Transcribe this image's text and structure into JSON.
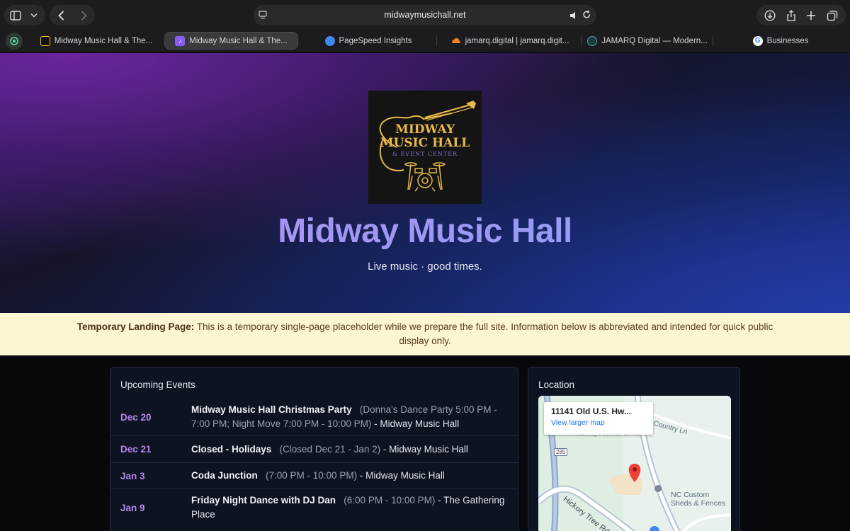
{
  "browser": {
    "url": "midwaymusichall.net",
    "tabs": [
      {
        "label": "Midway Music Hall & The...",
        "active": false,
        "favicon_color": "#f3c400"
      },
      {
        "label": "Midway Music Hall & The...",
        "active": true,
        "favicon_color": "#8b5cf6"
      },
      {
        "label": "PageSpeed Insights",
        "active": false,
        "favicon_color": "#4285f4"
      },
      {
        "label": "jamarq.digital | jamarq.digit...",
        "active": false,
        "favicon_color": "#f38020"
      },
      {
        "label": "JAMARQ Digital — Modern...",
        "active": false,
        "favicon_color": "#3fa6a6"
      },
      {
        "label": "Businesses",
        "active": false,
        "favicon_color": "#4285f4"
      }
    ]
  },
  "hero": {
    "logo": {
      "line1": "MIDWAY",
      "line2": "MUSIC HALL",
      "line3": "& EVENT CENTER"
    },
    "title": "Midway Music Hall",
    "subtitle": "Live music · good times."
  },
  "notice": {
    "label": "Temporary Landing Page:",
    "text": "This is a temporary single-page placeholder while we prepare the full site. Information below is abbreviated and intended for quick public display only."
  },
  "events": {
    "heading": "Upcoming Events",
    "items": [
      {
        "date": "Dec 20",
        "title": "Midway Music Hall Christmas Party",
        "time": "(Donna's Dance Party 5:00 PM - 7:00 PM; Night Move 7:00 PM - 10:00 PM)",
        "venue": "- Midway Music Hall"
      },
      {
        "date": "Dec 21",
        "title": "Closed - Holidays",
        "time": "(Closed Dec 21 - Jan 2)",
        "venue": "- Midway Music Hall"
      },
      {
        "date": "Jan 3",
        "title": "Coda Junction",
        "time": "(7:00 PM - 10:00 PM)",
        "venue": "- Midway Music Hall"
      },
      {
        "date": "Jan 9",
        "title": "Friday Night Dance with DJ Dan",
        "time": "(6:00 PM - 10:00 PM)",
        "venue": "- The Gathering Place"
      }
    ]
  },
  "location": {
    "heading": "Location",
    "map": {
      "address": "11141 Old U.S. Hw...",
      "link": "View larger map",
      "labels": {
        "country_ln": "Country Ln",
        "animal_clinic": "Midway Animal Clinic",
        "hickory": "Hickory Tree Rd",
        "shield": "285",
        "sheds_1": "NC Custom",
        "sheds_2": "Sheds & Fences"
      }
    }
  },
  "colors": {
    "accent_purple": "#b487f0",
    "notice_bg": "#fcf6d3",
    "logo_gold": "#e9b949"
  }
}
